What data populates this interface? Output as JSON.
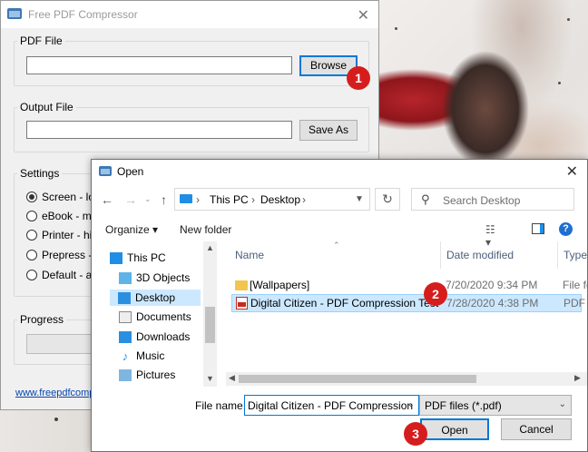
{
  "fpc": {
    "title": "Free PDF Compressor",
    "pdf_file_label": "PDF File",
    "browse_label": "Browse",
    "output_file_label": "Output File",
    "save_as_label": "Save As",
    "settings_label": "Settings",
    "radios": [
      {
        "label": "Screen - low",
        "selected": true
      },
      {
        "label": "eBook - medi",
        "selected": false
      },
      {
        "label": "Printer - high",
        "selected": false
      },
      {
        "label": "Prepress - hig",
        "selected": false
      },
      {
        "label": "Default - a wi",
        "selected": false
      }
    ],
    "progress_label": "Progress",
    "link": "www.freepdfcompre"
  },
  "badges": [
    "1",
    "2",
    "3"
  ],
  "open_dialog": {
    "title": "Open",
    "breadcrumb": [
      "This PC",
      "Desktop"
    ],
    "search_placeholder": "Search Desktop",
    "organize_label": "Organize",
    "new_folder_label": "New folder",
    "nav_items": [
      {
        "label": "This PC",
        "icon": "pc-icon"
      },
      {
        "label": "3D Objects",
        "icon": "cube-icon"
      },
      {
        "label": "Desktop",
        "icon": "desktop-icon",
        "selected": true
      },
      {
        "label": "Documents",
        "icon": "documents-icon"
      },
      {
        "label": "Downloads",
        "icon": "downloads-icon"
      },
      {
        "label": "Music",
        "icon": "music-icon"
      },
      {
        "label": "Pictures",
        "icon": "pictures-icon"
      }
    ],
    "columns": [
      "Name",
      "Date modified",
      "Type"
    ],
    "files": [
      {
        "name": "[Wallpapers]",
        "date": "7/20/2020 9:34 PM",
        "type": "File fo",
        "icon": "folder-icon"
      },
      {
        "name": "Digital Citizen - PDF Compression Test",
        "date": "7/28/2020 4:38 PM",
        "type": "PDF Fi",
        "icon": "pdf-icon",
        "selected": true
      }
    ],
    "file_name_label": "File name:",
    "file_name_value": "Digital Citizen - PDF Compression",
    "file_type_value": "PDF files (*.pdf)",
    "open_label": "Open",
    "cancel_label": "Cancel"
  },
  "colors": {
    "accent": "#0078d7",
    "badge": "#d61d1d",
    "selection": "#cce8ff"
  }
}
